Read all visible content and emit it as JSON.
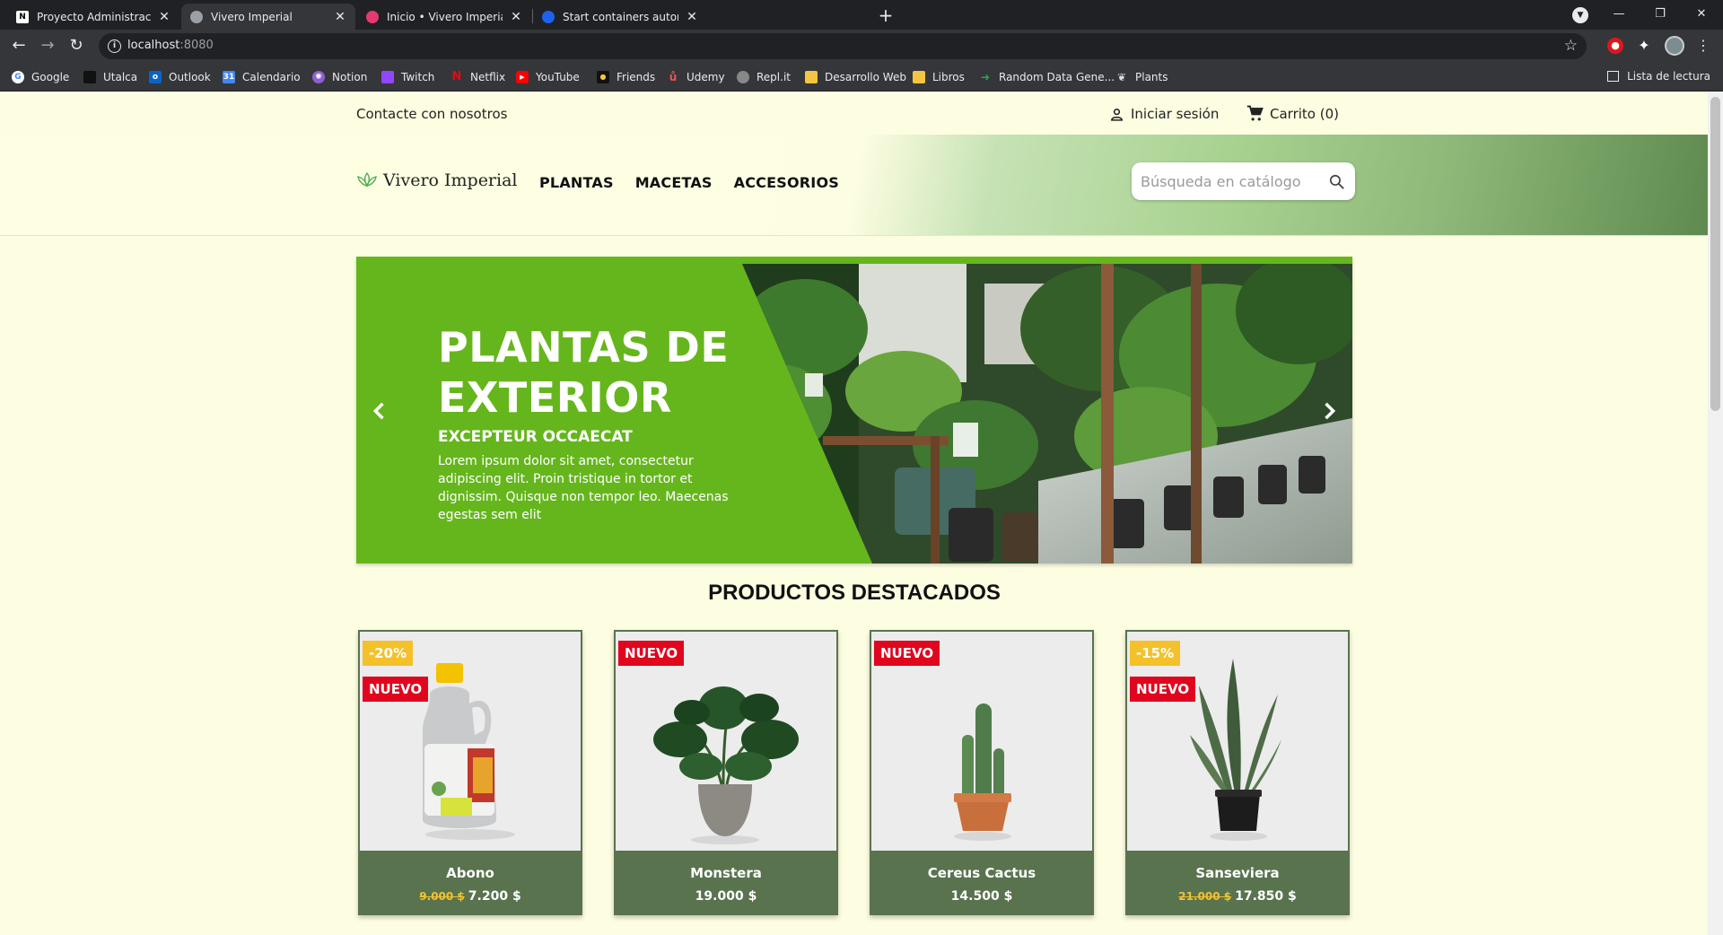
{
  "browser": {
    "tabs": [
      {
        "title": "Proyecto Administración de Redes",
        "favicon": "notion-icon",
        "active": false
      },
      {
        "title": "Vivero Imperial",
        "favicon": "globe-icon",
        "active": true
      },
      {
        "title": "Inicio • Vivero Imperial",
        "favicon": "site-icon",
        "active": false
      },
      {
        "title": "Start containers automatically | D",
        "favicon": "docker-icon",
        "active": false
      }
    ],
    "url_host": "localhost",
    "url_port": ":8080",
    "bookmarks": [
      {
        "label": "Google",
        "icon": "google-icon",
        "color": "#ffffff"
      },
      {
        "label": "Utalca",
        "icon": "utalca-icon",
        "color": "#222222"
      },
      {
        "label": "Outlook",
        "icon": "outlook-icon",
        "color": "#0a64c8"
      },
      {
        "label": "Calendario",
        "icon": "calendar-icon",
        "color": "#4285f4"
      },
      {
        "label": "Notion",
        "icon": "react-icon",
        "color": "#8c5fd6"
      },
      {
        "label": "Twitch",
        "icon": "twitch-icon",
        "color": "#9146ff"
      },
      {
        "label": "Netflix",
        "icon": "netflix-icon",
        "color": "#e50914"
      },
      {
        "label": "YouTube",
        "icon": "youtube-icon",
        "color": "#ff0000"
      },
      {
        "label": "Friends",
        "icon": "friends-icon",
        "color": "#111111"
      },
      {
        "label": "Udemy",
        "icon": "udemy-icon",
        "color": "#ec5252"
      },
      {
        "label": "Repl.it",
        "icon": "replit-icon",
        "color": "#888888"
      },
      {
        "label": "Desarrollo Web",
        "icon": "folder-icon",
        "color": "#f5c542"
      },
      {
        "label": "Libros",
        "icon": "folder-icon",
        "color": "#f5c542"
      },
      {
        "label": "Random Data Gene...",
        "icon": "arrow-icon",
        "color": "#2aa84a"
      },
      {
        "label": "Plants",
        "icon": "plant-icon",
        "color": "#dddddd"
      }
    ],
    "reading_list": "Lista de lectura"
  },
  "site": {
    "contact": "Contacte con nosotros",
    "login": "Iniciar sesión",
    "cart": "Carrito (0)",
    "brand": "Vivero Imperial",
    "menu": [
      "PLANTAS",
      "MACETAS",
      "ACCESORIOS"
    ],
    "search_placeholder": "Búsqueda en catálogo"
  },
  "hero": {
    "title": "PLANTAS DE EXTERIOR",
    "subtitle": "EXCEPTEUR OCCAECAT",
    "body": "Lorem ipsum dolor sit amet, consectetur adipiscing elit. Proin tristique in tortor et dignissim. Quisque non tempor leo. Maecenas egestas sem elit"
  },
  "featured": {
    "title": "PRODUCTOS DESTACADOS",
    "products": [
      {
        "name": "Abono",
        "old_price": "9.000 $",
        "price": "7.200 $",
        "discount": "-20%",
        "badge": "NUEVO"
      },
      {
        "name": "Monstera",
        "old_price": "",
        "price": "19.000 $",
        "discount": "",
        "badge": "NUEVO"
      },
      {
        "name": "Cereus Cactus",
        "old_price": "",
        "price": "14.500 $",
        "discount": "",
        "badge": "NUEVO"
      },
      {
        "name": "Sanseviera",
        "old_price": "21.000 $",
        "price": "17.850 $",
        "discount": "-15%",
        "badge": "NUEVO"
      }
    ]
  },
  "colors": {
    "page_bg": "#fdfde2",
    "hero_green": "#65b61d",
    "card_footer": "#59734e",
    "badge_new": "#e0061e",
    "badge_sale": "#f4c12b"
  }
}
